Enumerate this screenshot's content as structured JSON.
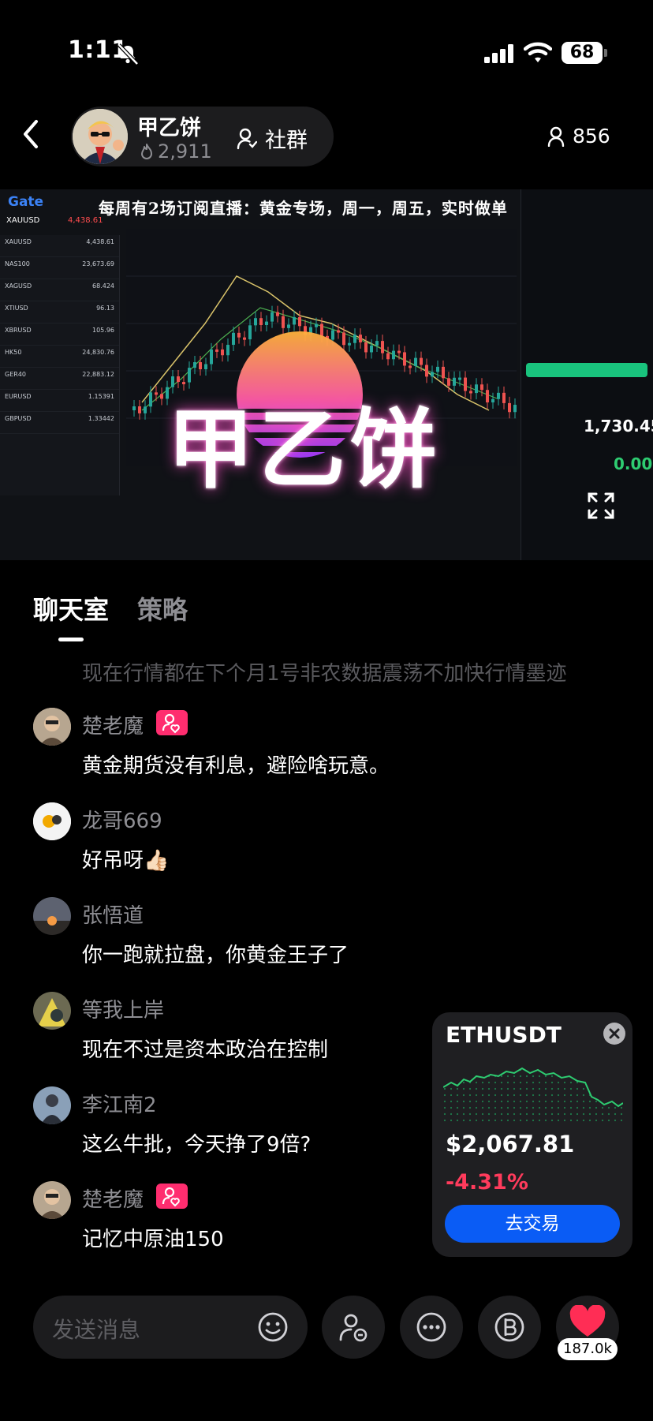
{
  "status": {
    "time": "1:11",
    "battery": "68"
  },
  "header": {
    "host_name": "甲乙饼",
    "host_likes": "2,911",
    "community_label": "社群",
    "viewer_count": "856"
  },
  "video": {
    "logo": "Gate",
    "banner": "每周有2场订阅直播：黄金专场，周一，周五，实时做单",
    "overlay_name": "甲乙饼",
    "side_price": "1,730.45",
    "side_change": "0.00",
    "symbol": "XAUUSD",
    "symbol_price": "4,438.61",
    "watchlist": [
      {
        "sym": "XAUUSD",
        "val": "4,438.61"
      },
      {
        "sym": "NAS100",
        "val": "23,673.69"
      },
      {
        "sym": "XAGUSD",
        "val": "68.424"
      },
      {
        "sym": "XTIUSD",
        "val": "96.13"
      },
      {
        "sym": "XBRUSD",
        "val": "105.96"
      },
      {
        "sym": "HK50",
        "val": "24,830.76"
      },
      {
        "sym": "GER40",
        "val": "22,883.12"
      },
      {
        "sym": "EURUSD",
        "val": "1.15391"
      },
      {
        "sym": "GBPUSD",
        "val": "1.33442"
      }
    ]
  },
  "tabs": {
    "chat": "聊天室",
    "strategy": "策略"
  },
  "ghost_message": "现在行情都在下个月1号非农数据震荡不加快行情墨迹",
  "messages": [
    {
      "name": "楚老魔",
      "text": "黄金期货没有利息，避险啥玩意。"
    },
    {
      "name": "龙哥669",
      "text": "好吊呀👍🏻"
    },
    {
      "name": "张悟道",
      "text": "你一跑就拉盘，你黄金王子了"
    },
    {
      "name": "等我上岸",
      "text": "现在不过是资本政治在控制"
    },
    {
      "name": "李江南2",
      "text": "这么牛批，今天挣了9倍?"
    },
    {
      "name": "楚老魔",
      "text": "记忆中原油150"
    }
  ],
  "ticker_card": {
    "symbol": "ETHUSDT",
    "price": "$2,067.81",
    "change": "-4.31%",
    "button": "去交易"
  },
  "bottom": {
    "input_placeholder": "发送消息",
    "like_count": "187.0k"
  },
  "colors": {
    "accent_blue": "#0a5cf5",
    "down_red": "#ff3b5c",
    "up_green": "#2ecc71",
    "badge_pink": "#ff2d6f"
  }
}
